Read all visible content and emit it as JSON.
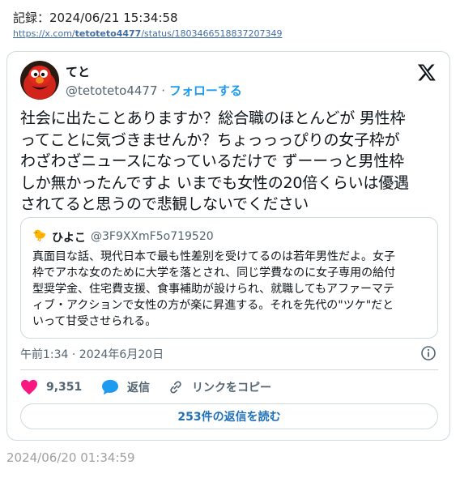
{
  "record_label": "記録：2024/06/21 15:34:58",
  "url": {
    "prefix": "https://x.com/",
    "user": "tetoteto4477",
    "suffix": "/status/1803466518837207349"
  },
  "tweet": {
    "author_name": "てと",
    "author_handle": "@tetoteto4477",
    "separator": "·",
    "follow_label": "フォローする",
    "text_lines": [
      "社会に出たことありますか？総合職のほとんどが 男性枠",
      "ってことに気づきませんか？ちょっっっぴりの女子枠が",
      "わざわざニュースになっているだけで ずーーっと男性枠",
      "しか無かったんですよ いまでも女性の20倍くらいは優遇",
      "されてると思うので悲観しないでください"
    ],
    "timestamp": "午前1:34 · 2024年6月20日"
  },
  "quote": {
    "icon": "🐤",
    "author_name": "ひよこ",
    "author_handle": "@3F9XXmF5o719520",
    "text_lines": [
      "真面目な話、現代日本で最も性差別を受けてるのは若年男性だよ。女子",
      "枠でアホな女のために大学を落とされ、同じ学費なのに女子専用の給付",
      "型奨学金、住宅費支援、食事補助が設けられ、就職してもアファーマテ",
      "ィブ・アクションで女性の方が楽に昇進する。それを先代の\"ツケ\"だと",
      "いって甘受させられる。"
    ]
  },
  "actions": {
    "like_count": "9,351",
    "reply_label": "返信",
    "copy_link_label": "リンクをコピー"
  },
  "read_replies_label": "253件の返信を読む",
  "footer_date": "2024/06/20 01:34:59",
  "colors": {
    "accent": "#1d9bf0",
    "like": "#f91880",
    "muted": "#536471"
  }
}
